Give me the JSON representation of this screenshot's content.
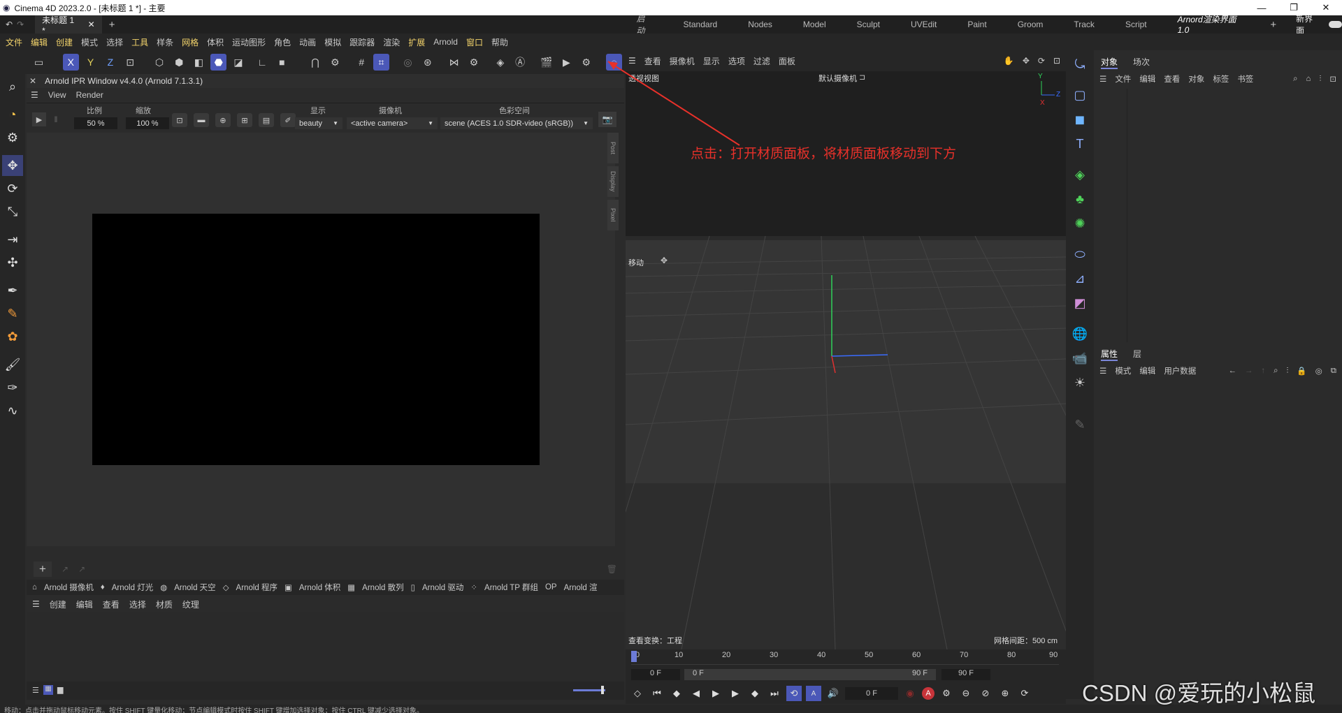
{
  "title": "Cinema 4D 2023.2.0 - [未标题 1 *] - 主要",
  "doc_tab": "未标题 1 *",
  "layouts": [
    "启动",
    "Standard",
    "Nodes",
    "Model",
    "Sculpt",
    "UVEdit",
    "Paint",
    "Groom",
    "Track",
    "Script",
    "Arnord渲染界面1.0"
  ],
  "new_layout": "新界面",
  "menu": [
    "文件",
    "编辑",
    "创建",
    "模式",
    "选择",
    "工具",
    "样条",
    "网格",
    "体积",
    "运动图形",
    "角色",
    "动画",
    "模拟",
    "跟踪器",
    "渲染",
    "扩展",
    "Arnold",
    "窗口",
    "帮助"
  ],
  "toolbar_axes": [
    "X",
    "Y",
    "Z"
  ],
  "ipr": {
    "title": "Arnold IPR Window v4.4.0 (Arnold 7.1.3.1)",
    "menu": [
      "View",
      "Render"
    ],
    "labels": {
      "ratio": "比例",
      "zoom": "缩放",
      "display": "显示",
      "camera": "摄像机",
      "colorspace": "色彩空间"
    },
    "ratio": "50 %",
    "zoom": "100 %",
    "display": "beauty",
    "camera": "<active camera>",
    "colorspace": "scene (ACES 1.0 SDR-video (sRGB))",
    "side_tabs": [
      "Post",
      "Display",
      "Pixel"
    ]
  },
  "arnold_objects": [
    "Arnold 摄像机",
    "Arnold 灯光",
    "Arnold 天空",
    "Arnold 程序",
    "Arnold 体积",
    "Arnold 散列",
    "Arnold 驱动",
    "Arnold TP 群组",
    "Arnold 渲"
  ],
  "arnold_op": "OP",
  "material_menu": [
    "创建",
    "编辑",
    "查看",
    "选择",
    "材质",
    "纹理"
  ],
  "viewport": {
    "menu": [
      "查看",
      "摄像机",
      "显示",
      "选项",
      "过滤",
      "面板"
    ],
    "view_name": "透视视图",
    "camera": "默认摄像机",
    "tool_label": "移动",
    "transform_label": "查看变换：工程",
    "grid_label": "网格间距：500 cm",
    "axis": [
      "Y",
      "Z",
      "X"
    ]
  },
  "annotation": "点击：打开材质面板，将材质面板移动到下方",
  "timeline": {
    "ticks": [
      "0",
      "10",
      "20",
      "30",
      "40",
      "50",
      "60",
      "70",
      "80",
      "90"
    ],
    "start": "0 F",
    "range_start": "0 F",
    "range_end": "90 F",
    "end": "90 F",
    "current": "0 F"
  },
  "objects_panel": {
    "tabs": [
      "对象",
      "场次"
    ],
    "menu": [
      "文件",
      "编辑",
      "查看",
      "对象",
      "标签",
      "书签"
    ]
  },
  "attributes_panel": {
    "tabs": [
      "属性",
      "层"
    ],
    "menu": [
      "模式",
      "编辑",
      "用户数据"
    ]
  },
  "status": "移动：点击并拖动鼠标移动元素。按住 SHIFT 键量化移动；节点编辑模式时按住 SHIFT 键增加选择对象；按住 CTRL 键减少选择对象。",
  "watermark": "CSDN @爱玩的小松鼠"
}
